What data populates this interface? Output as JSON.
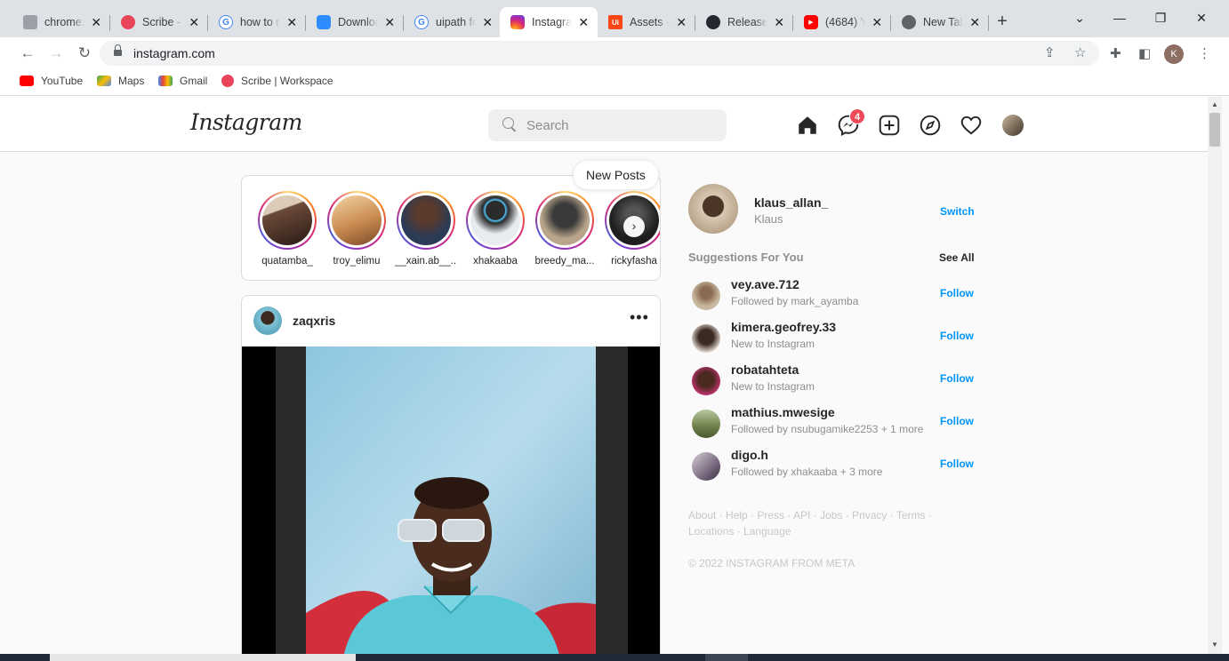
{
  "browser": {
    "tabs": [
      {
        "title": "chrome://",
        "icon": "chrome-icon",
        "color": "#9aa0a6"
      },
      {
        "title": "Scribe - ",
        "icon": "scribe-icon",
        "color": "#e8445a"
      },
      {
        "title": "how to r",
        "icon": "google-icon",
        "color": "#4285f4"
      },
      {
        "title": "Downloa",
        "icon": "zoom-icon",
        "color": "#2d8cff"
      },
      {
        "title": "uipath fo",
        "icon": "google-icon",
        "color": "#4285f4"
      },
      {
        "title": "Instagra",
        "icon": "instagram-icon",
        "color": "#d62976",
        "active": true
      },
      {
        "title": "Assets - ",
        "icon": "uipath-icon",
        "color": "#fa4616"
      },
      {
        "title": "Release ",
        "icon": "github-icon",
        "color": "#24292f"
      },
      {
        "title": "(4684) Y",
        "icon": "youtube-icon",
        "color": "#ff0000"
      },
      {
        "title": "New Tab",
        "icon": "chrome-icon",
        "color": "#5f6368"
      }
    ],
    "close_glyph": "✕",
    "new_tab_glyph": "+",
    "url": "instagram.com",
    "profile_initial": "K",
    "bookmarks": [
      {
        "label": "YouTube",
        "color": "#ff0000"
      },
      {
        "label": "Maps",
        "color": "#34a853"
      },
      {
        "label": "Gmail",
        "color": "#ea4335"
      },
      {
        "label": "Scribe | Workspace",
        "color": "#e8445a"
      }
    ]
  },
  "instagram": {
    "logo": "Instagram",
    "search_placeholder": "Search",
    "messenger_badge": "4",
    "new_posts": "New Posts",
    "stories": [
      {
        "name": "quatamba_",
        "color": "#6b4a3a"
      },
      {
        "name": "troy_elimu",
        "color": "#c98a4f"
      },
      {
        "name": "__xain.ab__...",
        "color": "#5a3a2c"
      },
      {
        "name": "xhakaaba",
        "color": "#e9ecef"
      },
      {
        "name": "breedy_ma...",
        "color": "#3a3a3a"
      },
      {
        "name": "rickyfasha",
        "color": "#1f1f1f"
      }
    ],
    "post": {
      "username": "zaqxris",
      "more": "•••"
    },
    "me": {
      "username": "klaus_allan_",
      "name": "Klaus",
      "switch": "Switch"
    },
    "suggestions_title": "Suggestions For You",
    "see_all": "See All",
    "follow_label": "Follow",
    "suggestions": [
      {
        "username": "vey.ave.712",
        "sub": "Followed by mark_ayamba",
        "color": "#c8b8a0"
      },
      {
        "username": "kimera.geofrey.33",
        "sub": "New to Instagram",
        "color": "#3a2a22"
      },
      {
        "username": "robatahteta",
        "sub": "New to Instagram",
        "color": "#b8326a"
      },
      {
        "username": "mathius.mwesige",
        "sub": "Followed by nsubugamike2253 + 1 more",
        "color": "#6f7f4a"
      },
      {
        "username": "digo.h",
        "sub": "Followed by xhakaaba + 3 more",
        "color": "#7a6a80"
      }
    ],
    "footer_links": "About · Help · Press · API · Jobs · Privacy · Terms · Locations · Language",
    "footer_copy": "© 2022 INSTAGRAM FROM META"
  }
}
